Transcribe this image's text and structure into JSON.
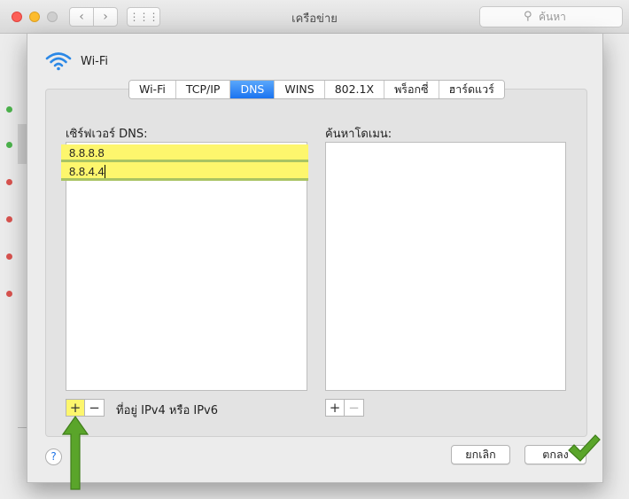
{
  "window": {
    "title": "เครือข่าย",
    "search_placeholder": "ค้นหา",
    "back_glyph": "‹",
    "forward_glyph": "›",
    "grid_glyph": "⋮⋮⋮"
  },
  "sheet": {
    "interface_name": "Wi-Fi",
    "tabs": [
      {
        "label": "Wi-Fi",
        "active": false
      },
      {
        "label": "TCP/IP",
        "active": false
      },
      {
        "label": "DNS",
        "active": true
      },
      {
        "label": "WINS",
        "active": false
      },
      {
        "label": "802.1X",
        "active": false
      },
      {
        "label": "พร็อกซี่",
        "active": false
      },
      {
        "label": "ฮาร์ดแวร์",
        "active": false
      }
    ],
    "dns_servers_label": "เซิร์ฟเวอร์ DNS:",
    "dns_servers": [
      "8.8.8.8",
      "8.8.4.4"
    ],
    "search_domains_label": "ค้นหาโดเมน:",
    "add_glyph": "+",
    "remove_glyph": "−",
    "address_hint": "ที่อยู่ IPv4 หรือ IPv6",
    "help_glyph": "?",
    "cancel_label": "ยกเลิก",
    "ok_label": "ตกลง"
  },
  "icons": {
    "wifi": "wifi-icon",
    "search": "search-icon",
    "annotation_arrow": "arrow-up-icon",
    "annotation_check": "checkmark-icon"
  },
  "colors": {
    "accent_blue": "#1a73f0",
    "highlight_yellow": "#fdf66d",
    "annotation_green": "#5aa52a"
  }
}
